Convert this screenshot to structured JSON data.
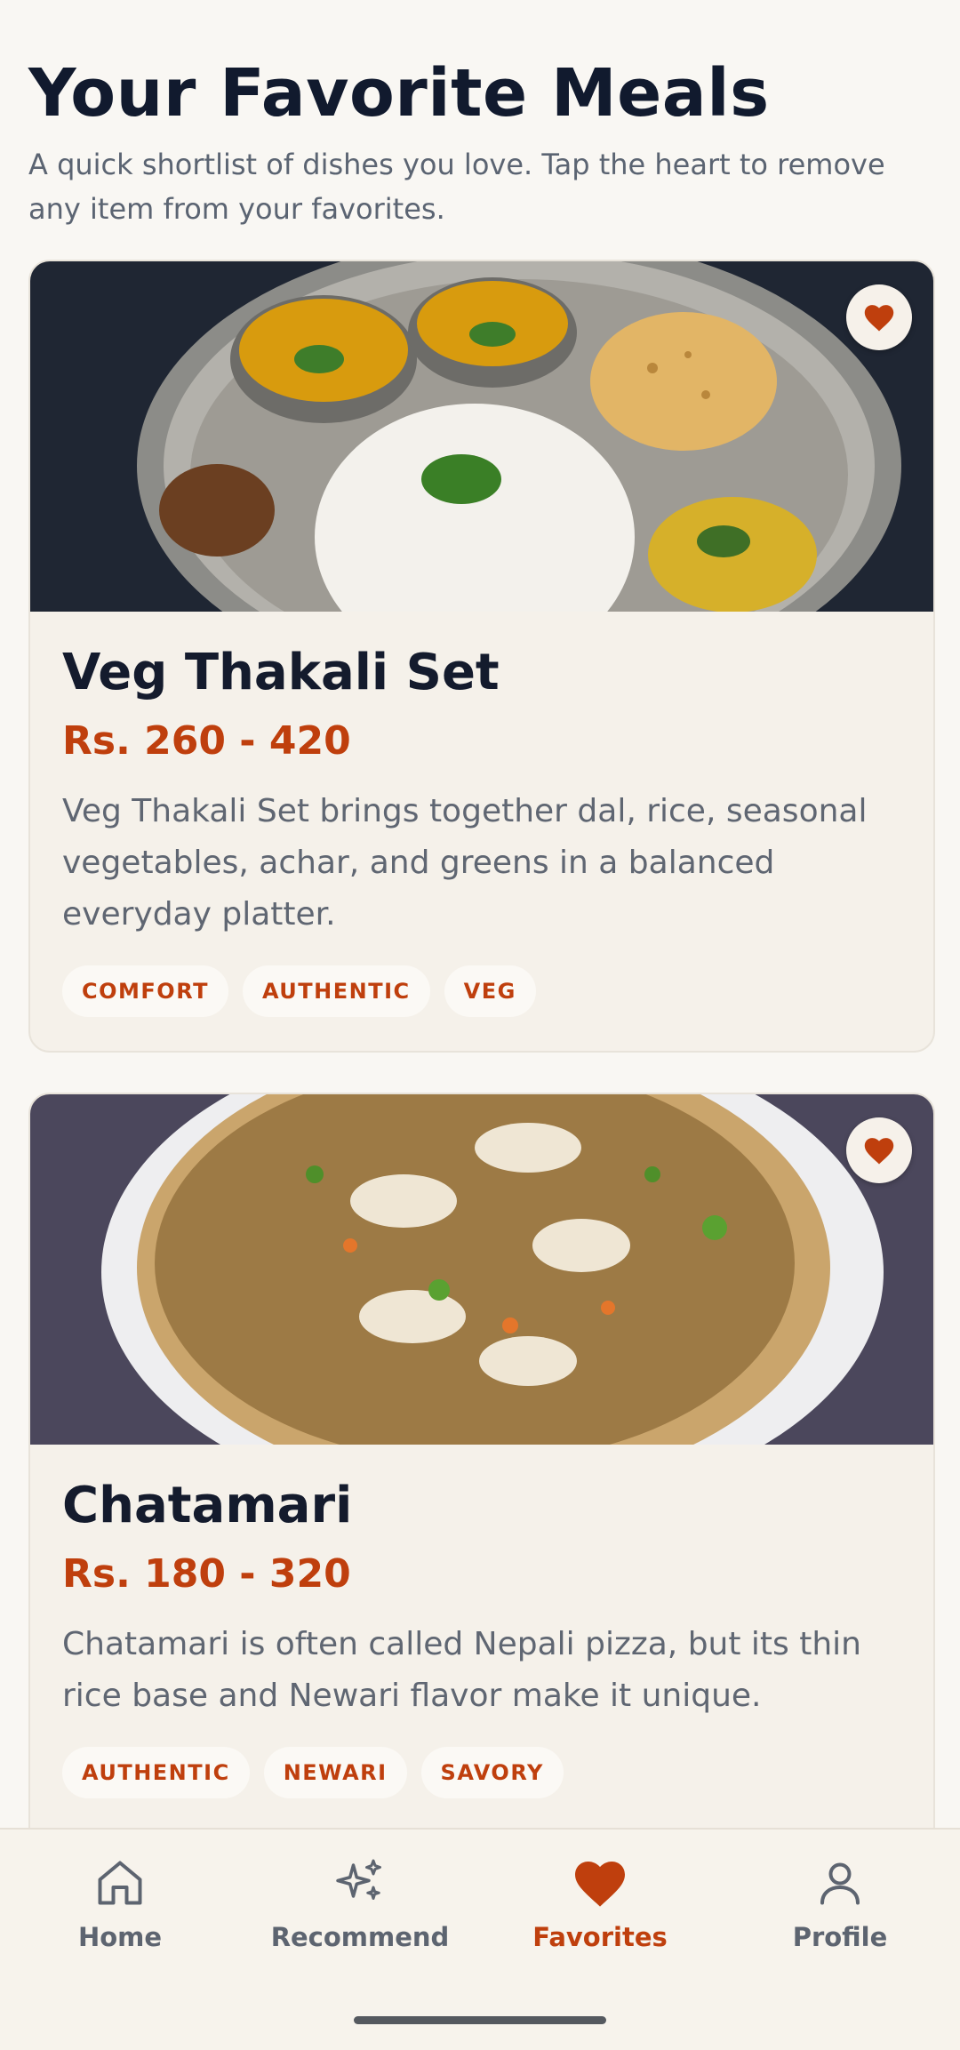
{
  "page": {
    "title": "Your Favorite Meals",
    "subtitle": "A quick shortlist of dishes you love. Tap the heart to remove any item from your favorites."
  },
  "meals": [
    {
      "name": "Veg Thakali Set",
      "price": "Rs. 260 - 420",
      "description": "Veg Thakali Set brings together dal, rice, seasonal vegetables, achar, and greens in a balanced everyday platter.",
      "tags": [
        "COMFORT",
        "AUTHENTIC",
        "VEG"
      ],
      "favorite": true
    },
    {
      "name": "Chatamari",
      "price": "Rs. 180 - 320",
      "description": "Chatamari is often called Nepali pizza, but its thin rice base and Newari flavor make it unique.",
      "tags": [
        "AUTHENTIC",
        "NEWARI",
        "SAVORY"
      ],
      "favorite": true
    }
  ],
  "nav": {
    "items": [
      {
        "label": "Home",
        "icon": "home-icon"
      },
      {
        "label": "Recommend",
        "icon": "sparkles-icon"
      },
      {
        "label": "Favorites",
        "icon": "heart-icon",
        "active": true
      },
      {
        "label": "Profile",
        "icon": "user-icon"
      }
    ]
  },
  "colors": {
    "accent": "#bf3f0d",
    "background": "#f9f7f3",
    "card": "#f5f1ea",
    "title": "#111a2e"
  }
}
